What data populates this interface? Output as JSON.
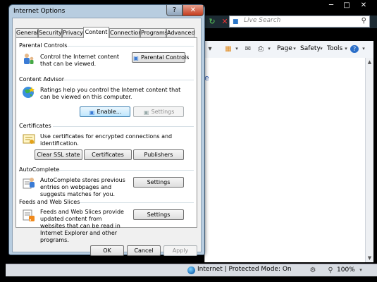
{
  "browser": {
    "search_placeholder": "Live Search",
    "cmdbar": {
      "page": "Page",
      "safety": "Safety",
      "tools": "Tools"
    },
    "status": {
      "zone": "Internet | Protected Mode: On",
      "zoom": "100%"
    }
  },
  "dialog": {
    "title": "Internet Options",
    "tabs": [
      {
        "label": "General"
      },
      {
        "label": "Security"
      },
      {
        "label": "Privacy"
      },
      {
        "label": "Content"
      },
      {
        "label": "Connections"
      },
      {
        "label": "Programs"
      },
      {
        "label": "Advanced"
      }
    ],
    "active_tab": "Content",
    "parental": {
      "label": "Parental Controls",
      "desc": "Control the Internet content that can be viewed.",
      "button": "Parental Controls"
    },
    "advisor": {
      "label": "Content Advisor",
      "desc": "Ratings help you control the Internet content that can be viewed on this computer.",
      "enable": "Enable...",
      "settings": "Settings"
    },
    "certificates": {
      "label": "Certificates",
      "desc": "Use certificates for encrypted connections and identification.",
      "clear_ssl": "Clear SSL state",
      "certificates": "Certificates",
      "publishers": "Publishers"
    },
    "autocomplete": {
      "label": "AutoComplete",
      "desc": "AutoComplete stores previous entries on webpages and suggests matches for you.",
      "settings": "Settings"
    },
    "feeds": {
      "label": "Feeds and Web Slices",
      "desc": "Feeds and Web Slices provide updated content from websites that can be read in Internet Explorer and other programs.",
      "settings": "Settings"
    },
    "footer": {
      "ok": "OK",
      "cancel": "Cancel",
      "apply": "Apply"
    }
  }
}
